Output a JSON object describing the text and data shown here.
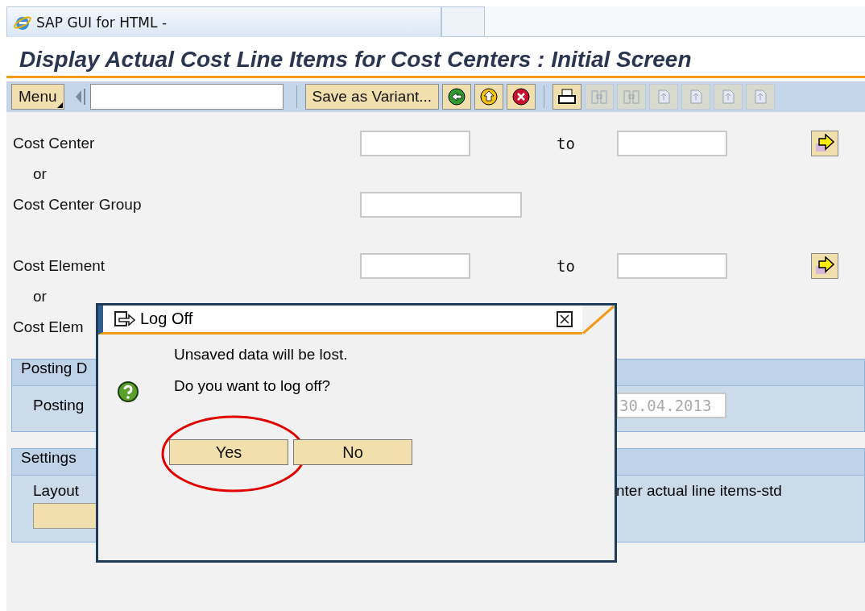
{
  "browser_tab": {
    "title": "SAP GUI for HTML -"
  },
  "screen_title": "Display Actual Cost Line Items for Cost Centers : Initial Screen",
  "toolbar": {
    "menu": "Menu",
    "variant_button": "Save as Variant...",
    "icon_buttons": [
      {
        "kind": "back",
        "disabled": false
      },
      {
        "kind": "exit",
        "disabled": false
      },
      {
        "kind": "cancel",
        "disabled": false
      }
    ],
    "page_buttons": [
      {
        "kind": "print",
        "disabled": false
      },
      {
        "kind": "find",
        "disabled": true
      },
      {
        "kind": "find_next",
        "disabled": true
      },
      {
        "kind": "first_page",
        "disabled": true
      },
      {
        "kind": "previous_page",
        "disabled": true
      },
      {
        "kind": "next_page",
        "disabled": true
      },
      {
        "kind": "last_page",
        "disabled": true
      }
    ]
  },
  "form_rows": [
    {
      "kind": "range",
      "label": "Cost Center",
      "to": "to"
    },
    {
      "kind": "or",
      "label": "or"
    },
    {
      "kind": "single",
      "label": "Cost Center Group"
    },
    {
      "kind": "range",
      "label": "Cost Element",
      "to": "to"
    },
    {
      "kind": "or",
      "label": "or"
    },
    {
      "kind": "label",
      "label": "Cost Elem"
    }
  ],
  "sections": [
    {
      "title": "Posting D",
      "kind": "date",
      "label": "Posting",
      "value": "30.04.2013"
    },
    {
      "title": "Settings",
      "kind": "layout",
      "label": "Layout",
      "text": "nter actual line items-std"
    }
  ],
  "dialog": {
    "title": "Log Off",
    "lines": [
      "Unsaved data will be lost.",
      "Do you want to log off?"
    ],
    "buttons": [
      {
        "label": "Yes",
        "highlighted": true
      },
      {
        "label": "No",
        "highlighted": false
      }
    ]
  }
}
